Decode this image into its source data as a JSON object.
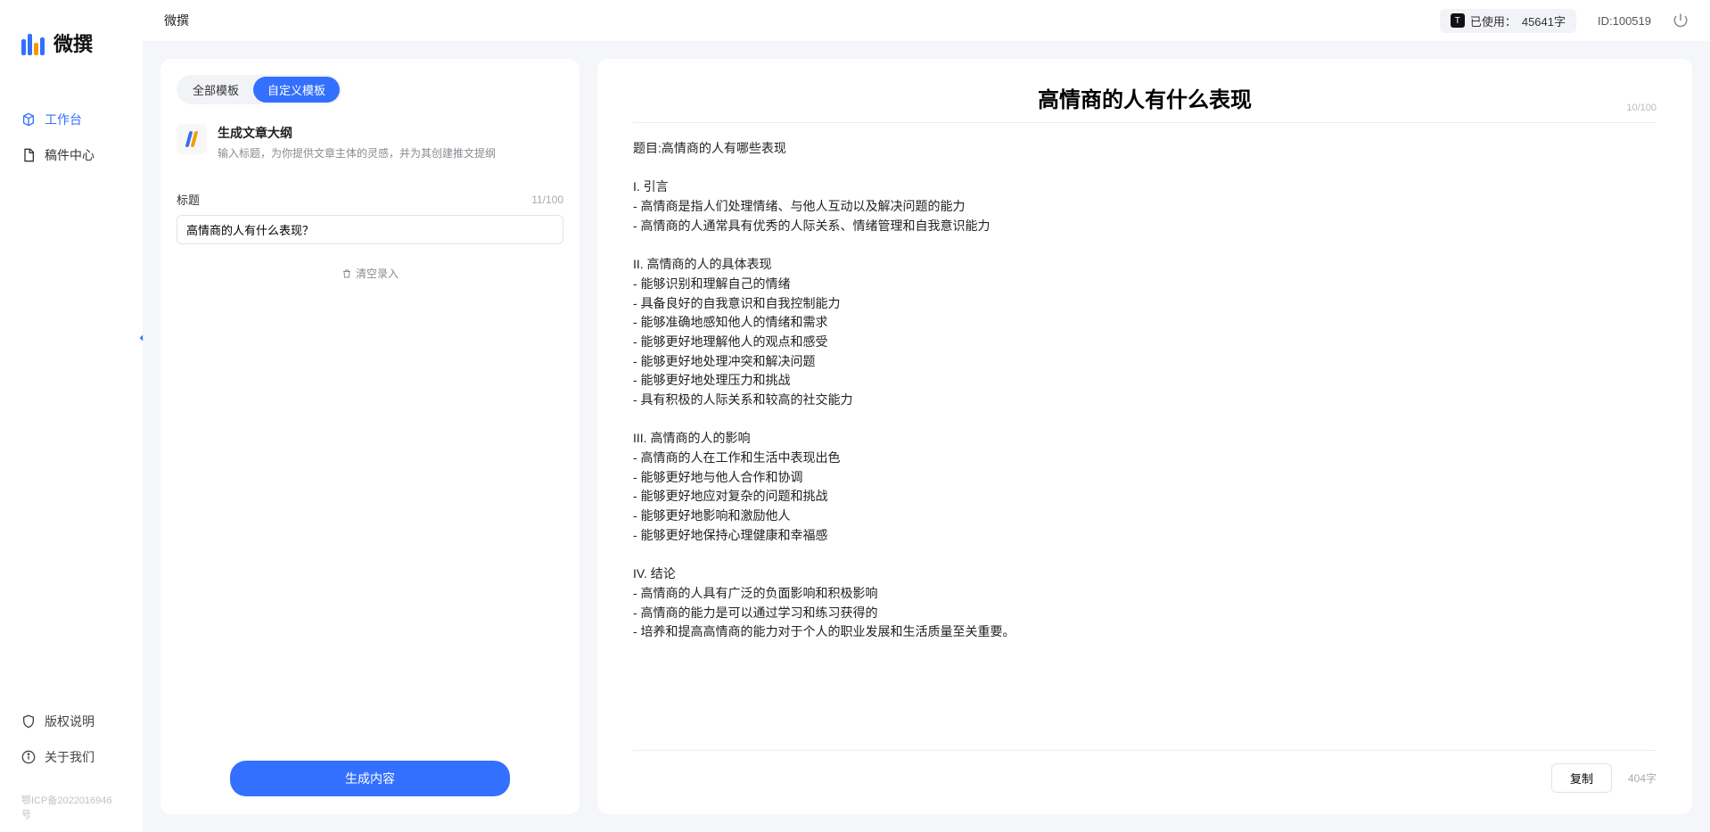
{
  "brand": {
    "name": "微撰"
  },
  "topbar": {
    "title": "微撰",
    "usage_prefix": "已使用：",
    "usage_value": "45641字",
    "id_label": "ID:100519"
  },
  "sidebar": {
    "items": [
      {
        "label": "工作台",
        "icon": "cube-icon",
        "active": true
      },
      {
        "label": "稿件中心",
        "icon": "document-icon",
        "active": false
      }
    ],
    "bottom": [
      {
        "label": "版权说明",
        "icon": "shield-icon"
      },
      {
        "label": "关于我们",
        "icon": "info-icon"
      }
    ],
    "icp": "鄂ICP备2022016946号"
  },
  "left": {
    "tabs": [
      {
        "label": "全部模板",
        "active": false
      },
      {
        "label": "自定义模板",
        "active": true
      }
    ],
    "template": {
      "title": "生成文章大纲",
      "desc": "输入标题，为你提供文章主体的灵感，并为其创建推文提纲"
    },
    "field": {
      "label": "标题",
      "counter": "11/100",
      "value": "高情商的人有什么表现？"
    },
    "clear_label": "清空录入",
    "generate_label": "生成内容"
  },
  "right": {
    "title": "高情商的人有什么表现",
    "title_counter": "10/100",
    "body": "题目:高情商的人有哪些表现\n\nI. 引言\n- 高情商是指人们处理情绪、与他人互动以及解决问题的能力\n- 高情商的人通常具有优秀的人际关系、情绪管理和自我意识能力\n\nII. 高情商的人的具体表现\n- 能够识别和理解自己的情绪\n- 具备良好的自我意识和自我控制能力\n- 能够准确地感知他人的情绪和需求\n- 能够更好地理解他人的观点和感受\n- 能够更好地处理冲突和解决问题\n- 能够更好地处理压力和挑战\n- 具有积极的人际关系和较高的社交能力\n\nIII. 高情商的人的影响\n- 高情商的人在工作和生活中表现出色\n- 能够更好地与他人合作和协调\n- 能够更好地应对复杂的问题和挑战\n- 能够更好地影响和激励他人\n- 能够更好地保持心理健康和幸福感\n\nIV. 结论\n- 高情商的人具有广泛的负面影响和积极影响\n- 高情商的能力是可以通过学习和练习获得的\n- 培养和提高高情商的能力对于个人的职业发展和生活质量至关重要。",
    "copy_label": "复制",
    "word_count": "404字"
  }
}
